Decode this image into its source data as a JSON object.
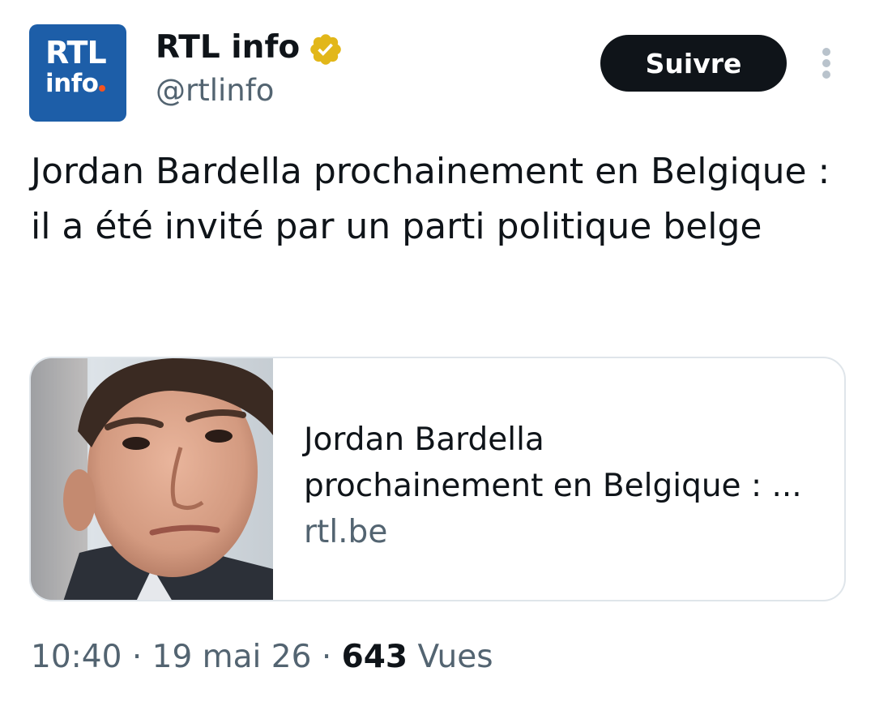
{
  "account": {
    "avatar_logo_line1": "RTL",
    "avatar_logo_line2": "info",
    "display_name": "RTL info",
    "handle": "@rtlinfo",
    "verified_badge_color": "#e2b719"
  },
  "follow_button": {
    "label": "Suivre"
  },
  "tweet": {
    "text": "Jordan Bardella prochainement en Belgique : il a été invité par un parti politique belge"
  },
  "link_card": {
    "title_line1": "Jordan Bardella",
    "title_line2": "prochainement en Belgique : ...",
    "domain": "rtl.be"
  },
  "meta": {
    "time": "10:40",
    "separator": "·",
    "date": "19 mai 26",
    "views_count": "643",
    "views_label": "Vues"
  },
  "colors": {
    "text_primary": "#0f1419",
    "text_secondary": "#536471",
    "avatar_bg": "#1d5ea8",
    "card_border": "#dfe5ea",
    "follow_bg": "#0f1419"
  }
}
